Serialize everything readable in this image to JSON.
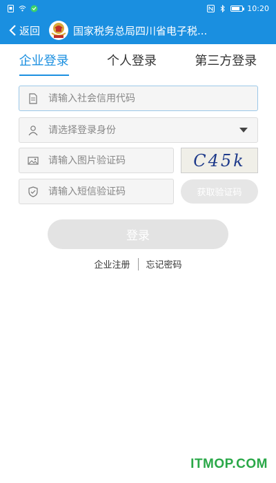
{
  "status_bar": {
    "time": "10:20",
    "left_icons": [
      "notification-icon",
      "wifi-icon",
      "message-icon"
    ],
    "right_icons": [
      "nfc-icon",
      "bluetooth-icon",
      "battery-icon"
    ],
    "battery_level": 0.8
  },
  "nav": {
    "back_label": "返回",
    "title": "国家税务总局四川省电子税..."
  },
  "tabs": [
    {
      "label": "企业登录",
      "active": true
    },
    {
      "label": "个人登录",
      "active": false
    },
    {
      "label": "第三方登录",
      "active": false
    }
  ],
  "form": {
    "credit_code_placeholder": "请输入社会信用代码",
    "identity_placeholder": "请选择登录身份",
    "image_code_placeholder": "请输入图片验证码",
    "captcha_text": "C45k",
    "sms_code_placeholder": "请输入短信验证码",
    "get_code_label": "获取验证码",
    "login_label": "登录"
  },
  "links": {
    "register_label": "企业注册",
    "forgot_label": "忘记密码"
  },
  "watermark": "ITMOP.COM",
  "colors": {
    "brand": "#1a8fe0",
    "disabled": "#e3e3e3",
    "watermark": "#2aa848"
  }
}
